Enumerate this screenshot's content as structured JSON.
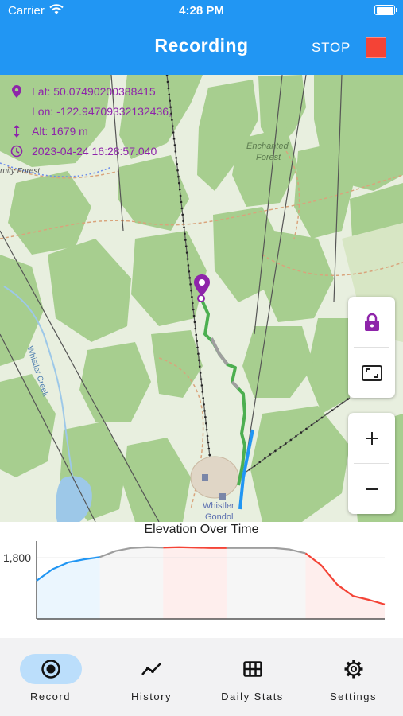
{
  "status_bar": {
    "carrier": "Carrier",
    "time": "4:28 PM"
  },
  "app_bar": {
    "title": "Recording",
    "stop_label": "STOP",
    "stop_color": "#F44336",
    "color": "#2196F3"
  },
  "location_info": {
    "lat": "Lat: 50.07490200388415",
    "lon": "Lon: -122.94709332132436,",
    "alt": "Alt: 1679 m",
    "timestamp": "2023-04-24 16:28:57.040",
    "text_color": "#8E24AA"
  },
  "map_labels": {
    "enchanted_1": "Enchanted",
    "enchanted_2": "Forest",
    "fruity_forest": "ruity Forest",
    "whistler_creek": "Whistler Creek",
    "whistler": "Whistler",
    "gondola": "Gondol"
  },
  "map_controls": [
    {
      "icon": "lock-icon"
    },
    {
      "icon": "fullscreen-icon"
    },
    {
      "icon": "zoom-in-icon"
    },
    {
      "icon": "zoom-out-icon"
    }
  ],
  "chart_data": {
    "type": "area",
    "title": "Elevation Over Time",
    "xlabel": "",
    "ylabel": "",
    "y_ticks": [
      "1,800"
    ],
    "series": [
      {
        "segments": [
          {
            "colour": "#2196F3",
            "values": [
              1740,
              1770,
              1788,
              1796,
              1802
            ]
          },
          {
            "colour": "#9E9E9E",
            "values": [
              1802,
              1818,
              1826,
              1828,
              1827
            ]
          },
          {
            "colour": "#F44336",
            "values": [
              1827,
              1828,
              1827,
              1826,
              1826
            ]
          },
          {
            "colour": "#9E9E9E",
            "values": [
              1826,
              1826,
              1826,
              1826,
              1822,
              1812
            ]
          },
          {
            "colour": "#F44336",
            "values": [
              1812,
              1780,
              1730,
              1700,
              1690,
              1678
            ]
          }
        ]
      }
    ]
  },
  "bottom_nav": {
    "items": [
      {
        "label": "Record",
        "icon": "record-icon",
        "active": true
      },
      {
        "label": "History",
        "icon": "history-icon",
        "active": false
      },
      {
        "label": "Daily Stats",
        "icon": "grid-icon",
        "active": false
      },
      {
        "label": "Settings",
        "icon": "gear-icon",
        "active": false
      }
    ]
  }
}
